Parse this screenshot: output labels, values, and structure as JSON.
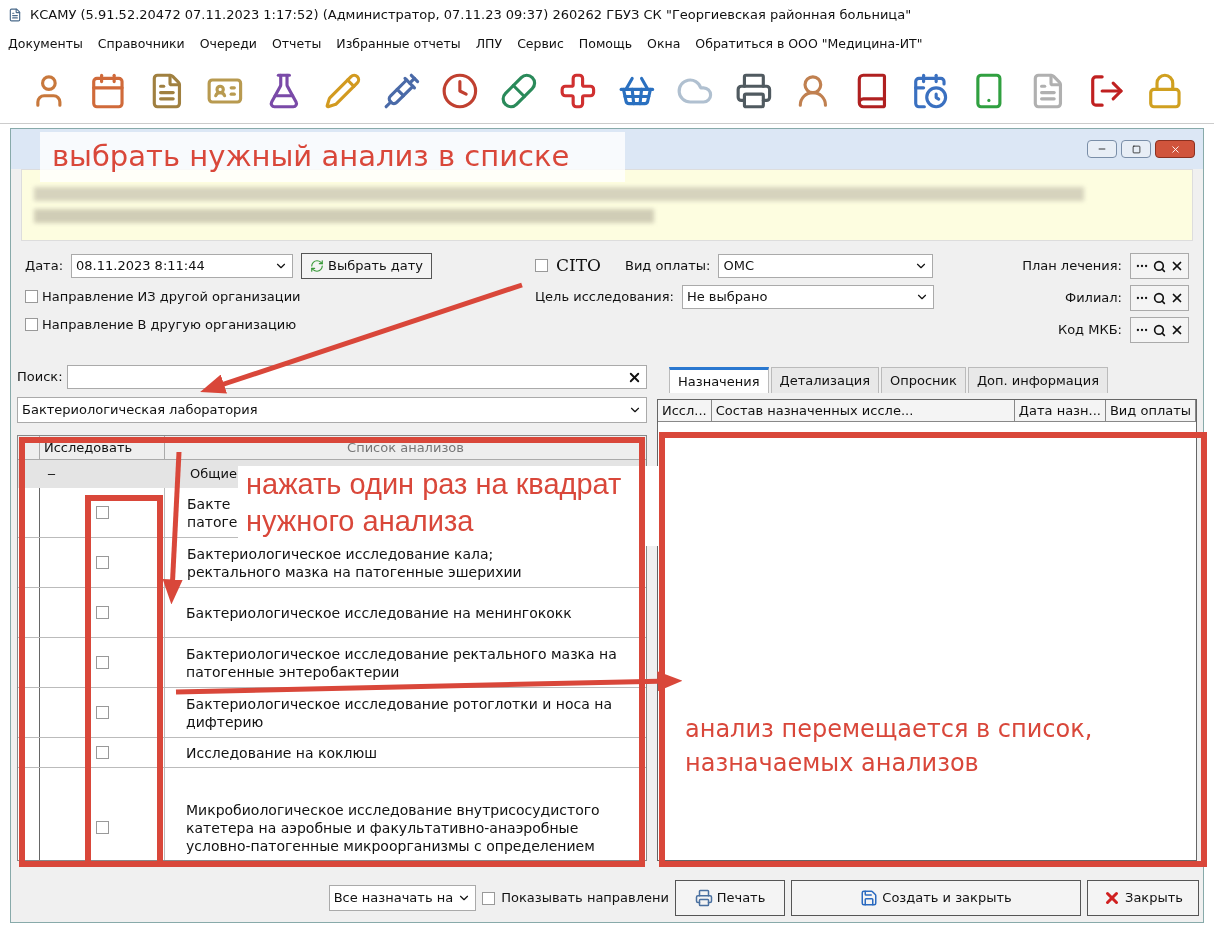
{
  "window": {
    "title": "КСАМУ (5.91.52.20472 07.11.2023 1:17:52) (Администратор, 07.11.23 09:37)  260262 ГБУЗ СК \"Георгиевская районная больница\""
  },
  "menu": [
    "Документы",
    "Справочники",
    "Очереди",
    "Отчеты",
    "Избранные отчеты",
    "ЛПУ",
    "Сервис",
    "Помощь",
    "Окна",
    "Обратиться в ООО \"Медицина-ИТ\""
  ],
  "form": {
    "date_label": "Дата:",
    "date_value": "08.11.2023 8:11:44",
    "pick_date_button": "Выбрать дату",
    "cito": {
      "label": "CITO",
      "checked": false
    },
    "payment_label": "Вид оплаты:",
    "payment_value": "ОМС",
    "purpose_label": "Цель исследования:",
    "purpose_value": "Не выбрано",
    "checkboxes": [
      {
        "label": "Направление ИЗ другой организации",
        "checked": false
      },
      {
        "label": "Направление В другую организацию",
        "checked": false
      }
    ],
    "lookups": [
      {
        "label": "План лечения:"
      },
      {
        "label": "Филиал:"
      },
      {
        "label": "Код МКБ:"
      }
    ]
  },
  "search": {
    "label": "Поиск:"
  },
  "lab_select": {
    "value": "Бактериологическая лаборатория"
  },
  "analyses": {
    "columns": [
      "Исследовать",
      "Список анализов"
    ],
    "group": "Общие",
    "rows": [
      {
        "lines": [
          "Бакте",
          "патоге"
        ],
        "checked": false
      },
      {
        "lines": [
          "Бактериологическое исследование кала;",
          "ректального мазка на патогенные эшерихии"
        ],
        "checked": false
      },
      {
        "name": "Бактериологическое исследование на менингококк",
        "checked": false
      },
      {
        "name": "Бактериологическое исследование ректального мазка на патогенные энтеробактерии",
        "checked": false
      },
      {
        "name": "Бактериологическое исследование ротоглотки и носа на дифтерию",
        "checked": false
      },
      {
        "name": "Исследование на коклюш",
        "checked": false
      },
      {
        "name": "Микробиологическое  исследование внутрисосудистого катетера на аэробные и факультативно-анаэробные условно-патогенные микроорганизмы с определением",
        "checked": false
      }
    ]
  },
  "tabs": [
    {
      "label": "Назначения",
      "selected": true
    },
    {
      "label": "Детализация",
      "selected": false
    },
    {
      "label": "Опросник",
      "selected": false
    },
    {
      "label": "Доп. информация",
      "selected": false
    }
  ],
  "assigned": {
    "columns": [
      "Иссл...",
      "Состав назначенных иссле...",
      "Дата назн...",
      "Вид оплаты"
    ]
  },
  "footer": {
    "assign_all": "Все назначать на",
    "show_referrals": {
      "label": "Показывать направлени",
      "checked": false
    },
    "buttons": [
      {
        "kind": "print",
        "label": "Печать"
      },
      {
        "kind": "save",
        "label": "Создать и закрыть"
      },
      {
        "kind": "close",
        "label": "Закрыть"
      }
    ]
  },
  "annotations": [
    {
      "kind": "top",
      "text": "выбрать нужный  анализ в списке"
    },
    {
      "kind": "middle",
      "text": "нажать один раз на квадрат нужного анализа"
    },
    {
      "kind": "right",
      "text": "анализ перемещается  в список, назначаемых анализов"
    }
  ]
}
